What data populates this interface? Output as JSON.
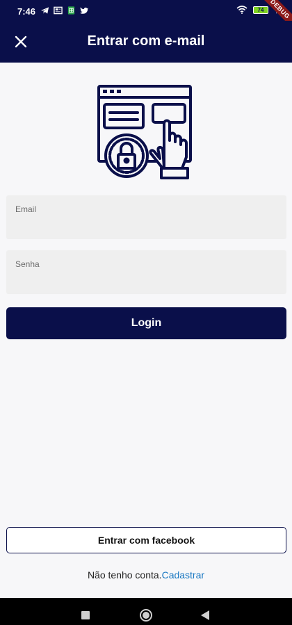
{
  "status_bar": {
    "time": "7:46",
    "battery": "74",
    "debug_label": "DEBUG",
    "icons_left": [
      "telegram-icon",
      "news-icon",
      "sheets-icon",
      "twitter-icon"
    ],
    "icons_right": [
      "wifi-icon",
      "battery-icon",
      "charging-icon"
    ]
  },
  "app_bar": {
    "title": "Entrar com e-mail",
    "close_icon": "close-icon",
    "background": "#0a0f4a"
  },
  "illustration": {
    "icon": "secure-login-touch-icon",
    "color": "#0a0f4a"
  },
  "form": {
    "email_label": "Email",
    "email_value": "",
    "password_label": "Senha",
    "password_value": "",
    "login_label": "Login"
  },
  "facebook": {
    "label": "Entrar com facebook"
  },
  "signup": {
    "prefix": "Não tenho conta.",
    "link": "Cadastrar",
    "link_color": "#1a78c2"
  },
  "nav_bar": {
    "icons": [
      "recent-apps-icon",
      "home-icon",
      "back-icon"
    ]
  }
}
